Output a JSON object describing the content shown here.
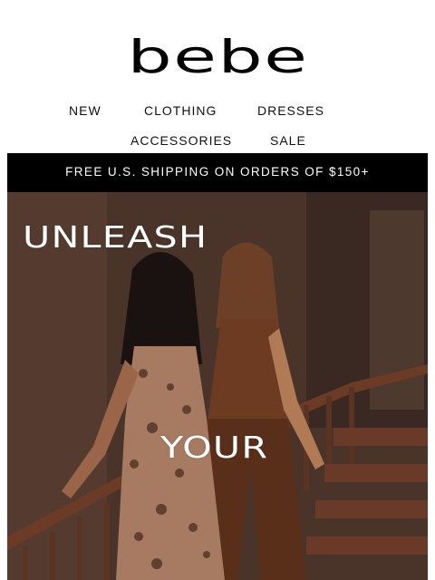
{
  "brand": {
    "logo_text": "bebe"
  },
  "nav": {
    "row1": [
      "NEW",
      "CLOTHING",
      "DRESSES"
    ],
    "row2": [
      "ACCESSORIES",
      "SALE"
    ]
  },
  "promo": {
    "text": "FREE U.S. SHIPPING ON ORDERS OF $150+"
  },
  "hero": {
    "headline_line1": "UNLEASH",
    "headline_line2": "YOUR"
  },
  "colors": {
    "promo_bg": "#000000",
    "headline": "#ffffff"
  }
}
